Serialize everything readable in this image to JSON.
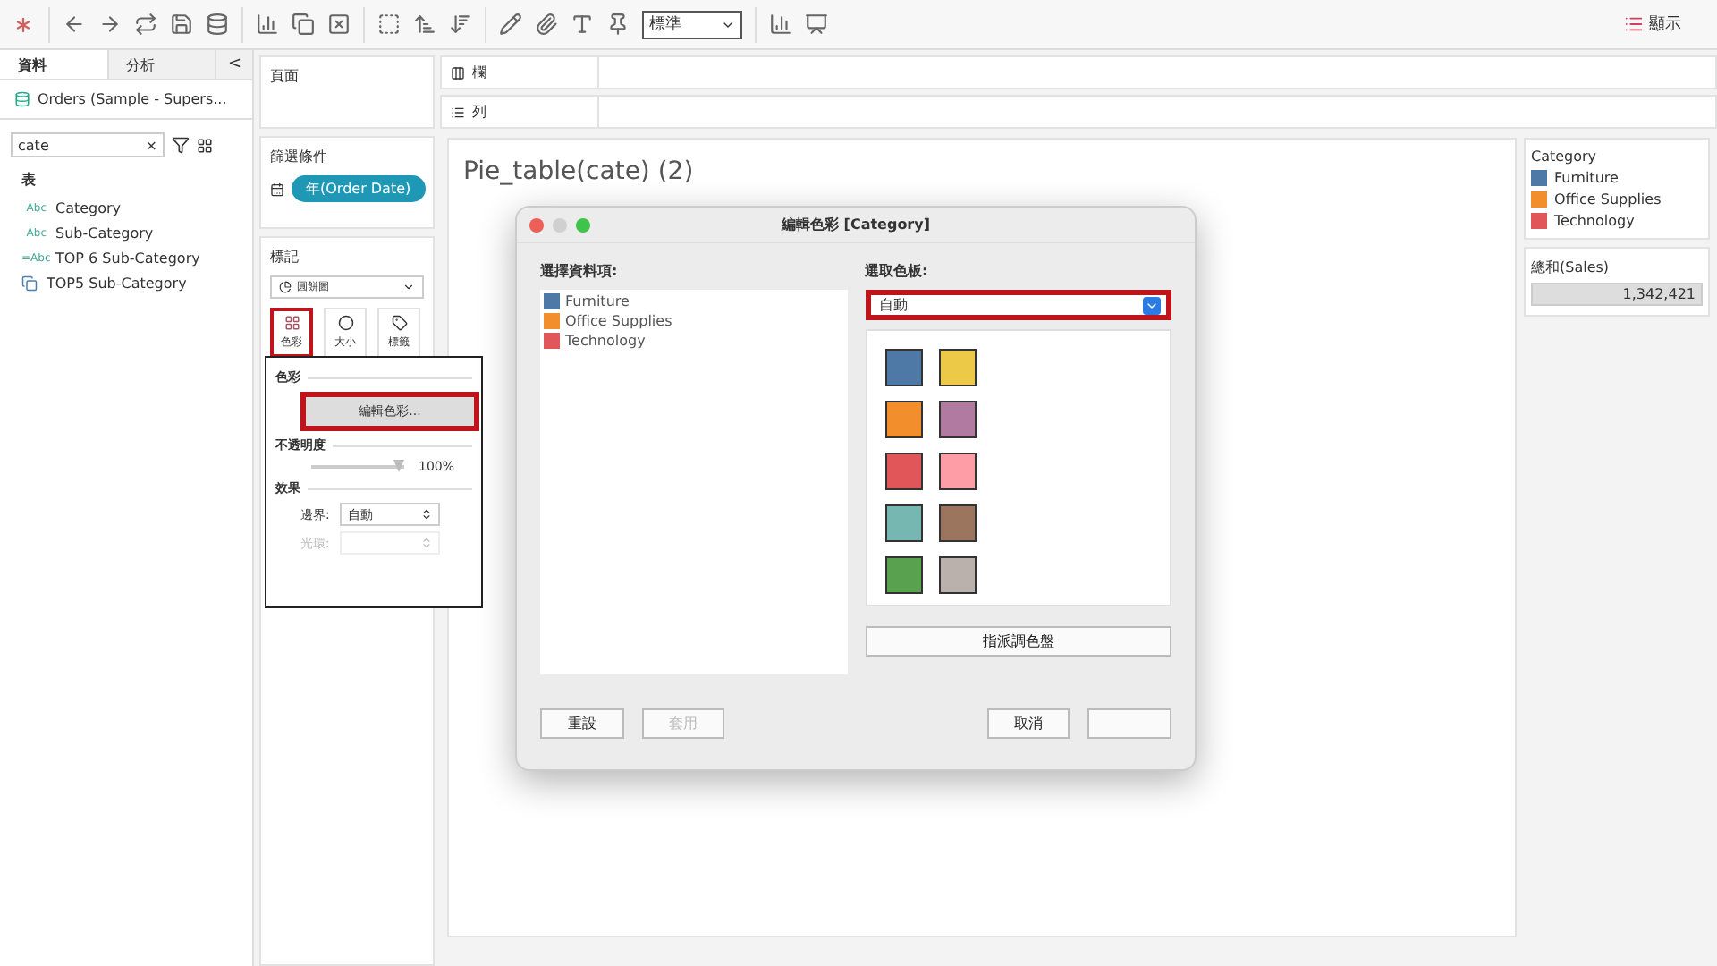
{
  "toolbar": {
    "fit_select": "標準",
    "show_me": "顯示"
  },
  "data_pane": {
    "tabs": [
      {
        "label": "資料",
        "selected": true
      },
      {
        "label": "分析",
        "selected": false
      }
    ],
    "collapse": "<",
    "datasource": "Orders (Sample - Supers...",
    "search": {
      "value": "cate",
      "clear": "×"
    },
    "section": "表",
    "fields": [
      {
        "kind": "string",
        "type_label": "Abc",
        "name": "Category"
      },
      {
        "kind": "string",
        "type_label": "Abc",
        "name": "Sub-Category"
      },
      {
        "kind": "calc",
        "type_label": "=Abc",
        "name": "TOP 6 Sub-Category"
      },
      {
        "kind": "set",
        "name": "TOP5 Sub-Category"
      }
    ]
  },
  "pages_shelf": {
    "title": "頁面"
  },
  "filters_shelf": {
    "title": "篩選條件",
    "pills": [
      "年(Order Date)"
    ]
  },
  "marks_card": {
    "title": "標記",
    "mark_type": "圓餅圖",
    "buttons": [
      {
        "kind": "color",
        "label": "色彩",
        "highlighted": true
      },
      {
        "kind": "size",
        "label": "大小",
        "highlighted": false
      },
      {
        "kind": "label",
        "label": "標籤",
        "highlighted": false
      }
    ]
  },
  "color_popup": {
    "color_title": "色彩",
    "edit_button": {
      "label": "編輯色彩...",
      "highlighted": true
    },
    "opacity_title": "不透明度",
    "opacity": {
      "level": 1,
      "reading": "100%"
    },
    "effects_title": "效果",
    "border": {
      "label": "邊界:",
      "value": "自動",
      "disabled": false
    },
    "halo": {
      "label": "光環:",
      "disabled": true
    }
  },
  "columns_shelf": {
    "title": "欄"
  },
  "rows_shelf": {
    "title": "列"
  },
  "sheet_title": "Pie_table(cate) (2)",
  "legend": {
    "title": "Category",
    "items": [
      {
        "label": "Furniture",
        "color": "#4e79a7"
      },
      {
        "label": "Office Supplies",
        "color": "#f28e2b"
      },
      {
        "label": "Technology",
        "color": "#e15759"
      }
    ]
  },
  "size_legend": {
    "title": "總和(Sales)",
    "value": "1,342,421"
  },
  "dialog": {
    "title": "編輯色彩 [Category]",
    "items_label": "選擇資料項:",
    "items": [
      {
        "label": "Furniture",
        "color": "#4e79a7"
      },
      {
        "label": "Office Supplies",
        "color": "#f28e2b"
      },
      {
        "label": "Technology",
        "color": "#e15759"
      }
    ],
    "palette_label": "選取色板:",
    "palette_select": {
      "value": "自動",
      "highlighted": true
    },
    "swatches": [
      {
        "color": "#4e79a7"
      },
      {
        "color": "#edc948"
      },
      {
        "color": "#f28e2b"
      },
      {
        "color": "#b07aa1"
      },
      {
        "color": "#e15759"
      },
      {
        "color": "#ff9da7"
      },
      {
        "color": "#76b7b2"
      },
      {
        "color": "#9c755f"
      },
      {
        "color": "#59a14f"
      },
      {
        "color": "#bab0ac"
      }
    ],
    "assign_button": "指派調色盤",
    "reset_button": "重設",
    "apply_button": {
      "label": "套用",
      "disabled": true
    },
    "cancel_button": "取消"
  }
}
